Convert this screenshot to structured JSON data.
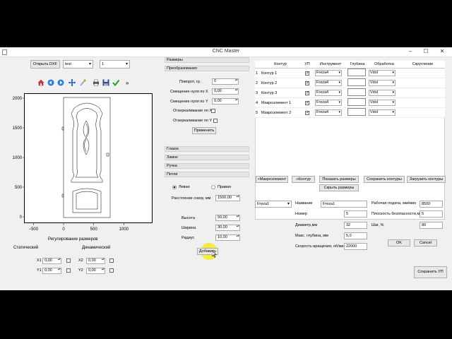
{
  "window": {
    "title": "CNC Master",
    "minimize": "–",
    "maximize": "☐",
    "close": "✕"
  },
  "top": {
    "open_dxf": "Открыть DXF",
    "file_combo": "test",
    "num_combo": "1"
  },
  "toolbar": [
    "home-icon",
    "back-arrow-icon",
    "forward-arrow-icon",
    "move-icon",
    "brush-icon",
    "print-icon",
    "save-icon",
    "check-icon",
    "more-icon"
  ],
  "toolbar_more": "»",
  "plot": {
    "yticks": [
      {
        "label": "2000",
        "value": 2000
      },
      {
        "label": "1500",
        "value": 1500
      },
      {
        "label": "1000",
        "value": 1000
      },
      {
        "label": "500",
        "value": 500
      },
      {
        "label": "0",
        "value": 0
      }
    ],
    "xticks": [
      {
        "label": "−500",
        "value": -500
      },
      {
        "label": "0",
        "value": 0
      },
      {
        "label": "500",
        "value": 500
      },
      {
        "label": "1000",
        "value": 1000
      }
    ]
  },
  "sizes_adjust": {
    "title": "Регулирование размеров",
    "static": "Статический",
    "dynamic": "Динамический",
    "x1_label": "X1",
    "x1_value": "0,00",
    "y1_label": "Y1",
    "y1_value": "0,00",
    "x2_label": "X2",
    "x2_value": "0,00",
    "y2_label": "Y2",
    "y2_value": "0,00"
  },
  "sections": {
    "sizes": "Размеры",
    "transform": "Преобразования",
    "peephole": "Глазок",
    "lock": "Замок",
    "handle": "Ручка",
    "hinges": "Петли"
  },
  "transform": {
    "rotate_label": "Поворот, гр.",
    "rotate_value": "0",
    "offset_x_label": "Смещение нуля по X",
    "offset_x_value": "0,00",
    "offset_y_label": "Смещение нуля по Y",
    "offset_y_value": "0,00",
    "mirror_x_label": "Отзеркаливание по X",
    "mirror_y_label": "Отзеркаливание по Y",
    "apply": "Применить"
  },
  "hinges": {
    "left": "Левая",
    "right": "Правая",
    "dist_label": "Расстояние снизу, мм",
    "dist_value": "1500,00",
    "height_label": "Высота",
    "height_value": "50,00",
    "width_label": "Ширина",
    "width_value": "30,00",
    "radius_label": "Радиус",
    "radius_value": "10,00",
    "add": "Добавить"
  },
  "contours": {
    "headers": [
      "Контур",
      "УП",
      "Инструмент",
      "Глубина",
      "Обработка",
      "Скругление"
    ],
    "rows": [
      {
        "n": "1",
        "name": "Контур 1",
        "tool": "Freza4",
        "process": "Vdol"
      },
      {
        "n": "2",
        "name": "Контур 2",
        "tool": "Freza4",
        "process": "Vdol"
      },
      {
        "n": "3",
        "name": "Контур 3",
        "tool": "Freza4",
        "process": "Vdol"
      },
      {
        "n": "4",
        "name": "Макроэлемент 1",
        "tool": "Freza4",
        "process": "Vdol"
      },
      {
        "n": "5",
        "name": "Макроэлемент 2",
        "tool": "Freza4",
        "process": "Vdol"
      }
    ],
    "checkmark": "✓"
  },
  "contour_buttons": {
    "macro": "«Макроэлемент",
    "contour": "«Контур",
    "show_sizes": "Показать размеры",
    "save_contours": "Сохранить контуры",
    "load_contours": "Загрузить контуры",
    "hide_sizes": "Скрыть размеры"
  },
  "tool": {
    "combo": "Freza1",
    "name_label": "Название",
    "name_value": "Freza1",
    "number_label": "Номер",
    "number_value": "5",
    "diameter_label": "Диаметр,мм",
    "diameter_value": "32",
    "depth_label": "Макс. глубина, мм",
    "depth_value": "5,0",
    "speed_label": "Скорость вращения, об/мин",
    "speed_value": "22000",
    "feed_label": "Рабочая подача, мм/мин",
    "feed_value": "8500",
    "safety_label": "Плоскость безопасности,мм",
    "safety_value": "5",
    "step_label": "Шаг, %",
    "step_value": "80",
    "ok": "OK",
    "cancel": "Cancel",
    "save_up": "Сохранить УП"
  },
  "colors": {
    "cursor_highlight": "#f5ea1a",
    "window_bg": "#f0f0f0"
  }
}
